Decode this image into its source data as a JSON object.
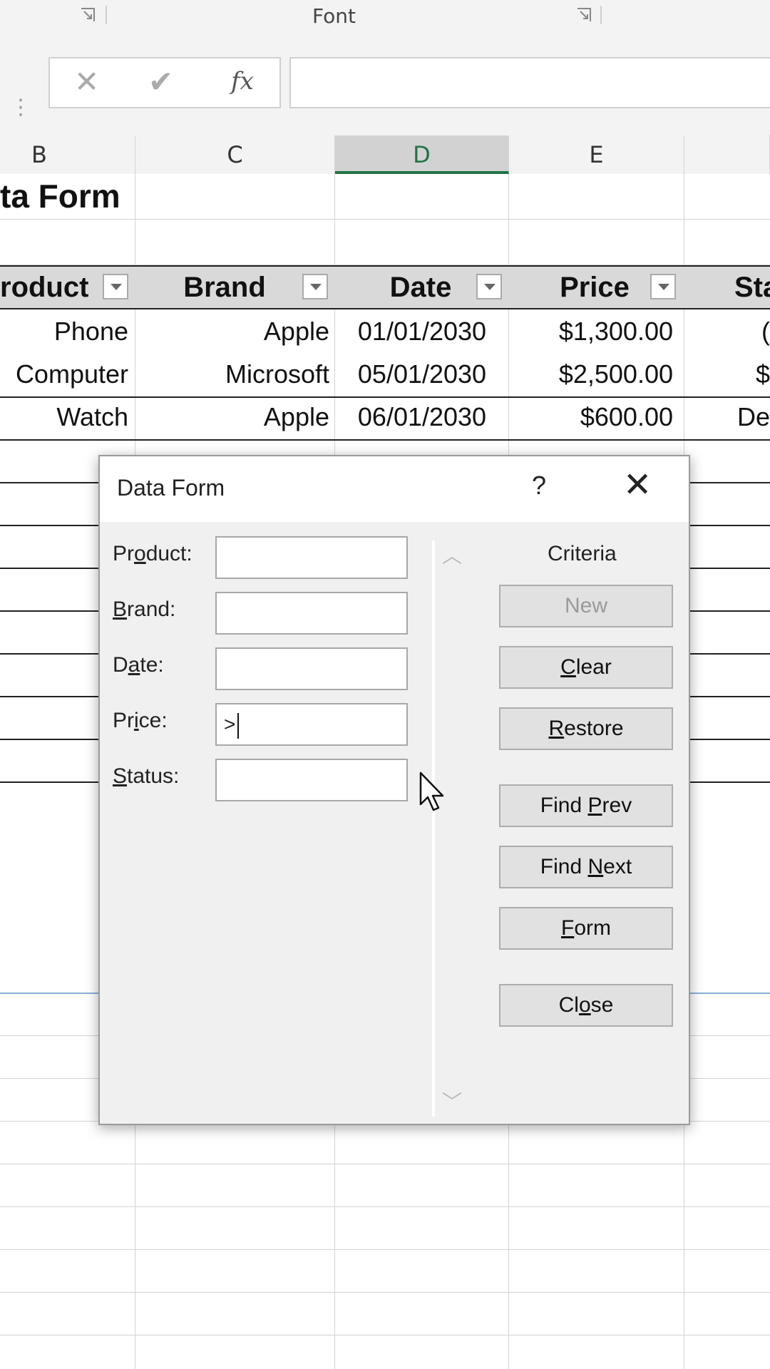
{
  "ribbon": {
    "group_label": "Font"
  },
  "formula_bar": {
    "cancel_glyph": "✕",
    "enter_glyph": "✔",
    "fx_label": "fx",
    "value": ""
  },
  "columns": [
    {
      "letter": "B"
    },
    {
      "letter": "C"
    },
    {
      "letter": "D"
    },
    {
      "letter": "E"
    }
  ],
  "sheet": {
    "title": "ta Form",
    "headers": [
      "roduct",
      "Brand",
      "Date",
      "Price",
      "Sta"
    ],
    "rows": [
      [
        "Phone",
        "Apple",
        "01/01/2030",
        "$1,300.00",
        "("
      ],
      [
        "Computer",
        "Microsoft",
        "05/01/2030",
        "$2,500.00",
        "$"
      ],
      [
        "Watch",
        "Apple",
        "06/01/2030",
        "$600.00",
        "De"
      ]
    ]
  },
  "dialog": {
    "title": "Data Form",
    "help": "?",
    "close_glyph": "✕",
    "mode_label": "Criteria",
    "fields": [
      {
        "label_pre": "Pr",
        "label_ul": "o",
        "label_post": "duct:",
        "value": ""
      },
      {
        "label_pre": "",
        "label_ul": "B",
        "label_post": "rand:",
        "value": ""
      },
      {
        "label_pre": "D",
        "label_ul": "a",
        "label_post": "te:",
        "value": ""
      },
      {
        "label_pre": "Pr",
        "label_ul": "i",
        "label_post": "ce:",
        "value": ">"
      },
      {
        "label_pre": "",
        "label_ul": "S",
        "label_post": "tatus:",
        "value": ""
      }
    ],
    "buttons": {
      "new": "New",
      "clear_ul": "C",
      "clear_rest": "lear",
      "restore_ul": "R",
      "restore_rest": "estore",
      "findprev_pre": "Find ",
      "findprev_ul": "P",
      "findprev_rest": "rev",
      "findnext_pre": "Find ",
      "findnext_ul": "N",
      "findnext_rest": "ext",
      "form_ul": "F",
      "form_rest": "orm",
      "close_pre": "Cl",
      "close_ul": "o",
      "close_rest": "se"
    },
    "scroll_up": "︿",
    "scroll_down": "﹀"
  }
}
